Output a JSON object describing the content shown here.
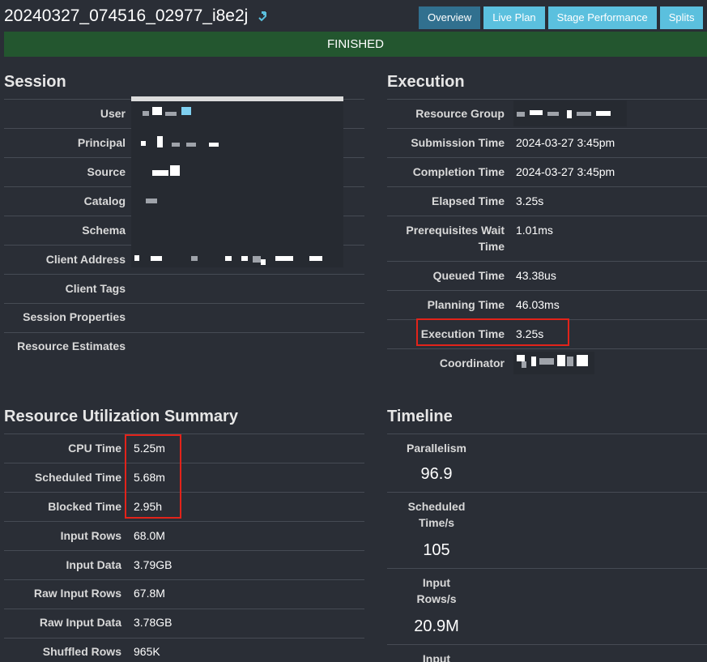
{
  "header": {
    "query_id": "20240327_074516_02977_i8e2j",
    "copy_icon": "clipboard-icon",
    "tabs": [
      {
        "label": "Overview",
        "active": true
      },
      {
        "label": "Live Plan",
        "active": false
      },
      {
        "label": "Stage Performance",
        "active": false
      },
      {
        "label": "Splits",
        "active": false
      }
    ]
  },
  "status": {
    "text": "FINISHED",
    "color": "#23562f"
  },
  "session": {
    "title": "Session",
    "rows": [
      {
        "label": "User",
        "value": ""
      },
      {
        "label": "Principal",
        "value": ""
      },
      {
        "label": "Source",
        "value": ""
      },
      {
        "label": "Catalog",
        "value": ""
      },
      {
        "label": "Schema",
        "value": ""
      },
      {
        "label": "Client Address",
        "value": ""
      },
      {
        "label": "Client Tags",
        "value": ""
      },
      {
        "label": "Session Properties",
        "value": ""
      },
      {
        "label": "Resource Estimates",
        "value": ""
      }
    ]
  },
  "execution": {
    "title": "Execution",
    "rows": [
      {
        "label": "Resource Group",
        "value": ""
      },
      {
        "label": "Submission Time",
        "value": "2024-03-27 3:45pm"
      },
      {
        "label": "Completion Time",
        "value": "2024-03-27 3:45pm"
      },
      {
        "label": "Elapsed Time",
        "value": "3.25s"
      },
      {
        "label_line1": "Prerequisites Wait",
        "label_line2": "Time",
        "value": "1.01ms"
      },
      {
        "label": "Queued Time",
        "value": "43.38us"
      },
      {
        "label": "Planning Time",
        "value": "46.03ms"
      },
      {
        "label": "Execution Time",
        "value": "3.25s"
      },
      {
        "label": "Coordinator",
        "value": ""
      }
    ]
  },
  "resource_utilization": {
    "title": "Resource Utilization Summary",
    "rows": [
      {
        "label": "CPU Time",
        "value": "5.25m"
      },
      {
        "label": "Scheduled Time",
        "value": "5.68m"
      },
      {
        "label": "Blocked Time",
        "value": "2.95h"
      },
      {
        "label": "Input Rows",
        "value": "68.0M"
      },
      {
        "label": "Input Data",
        "value": "3.79GB"
      },
      {
        "label": "Raw Input Rows",
        "value": "67.8M"
      },
      {
        "label": "Raw Input Data",
        "value": "3.78GB"
      },
      {
        "label": "Shuffled Rows",
        "value": "965K"
      }
    ]
  },
  "timeline": {
    "title": "Timeline",
    "items": [
      {
        "label_line1": "Parallelism",
        "label_line2": "",
        "value": "96.9"
      },
      {
        "label_line1": "Scheduled",
        "label_line2": "Time/s",
        "value": "105"
      },
      {
        "label_line1": "Input",
        "label_line2": "Rows/s",
        "value": "20.9M"
      },
      {
        "label_line1": "Input",
        "label_line2": "",
        "value": ""
      }
    ]
  },
  "annotation_color": "#e2231a"
}
